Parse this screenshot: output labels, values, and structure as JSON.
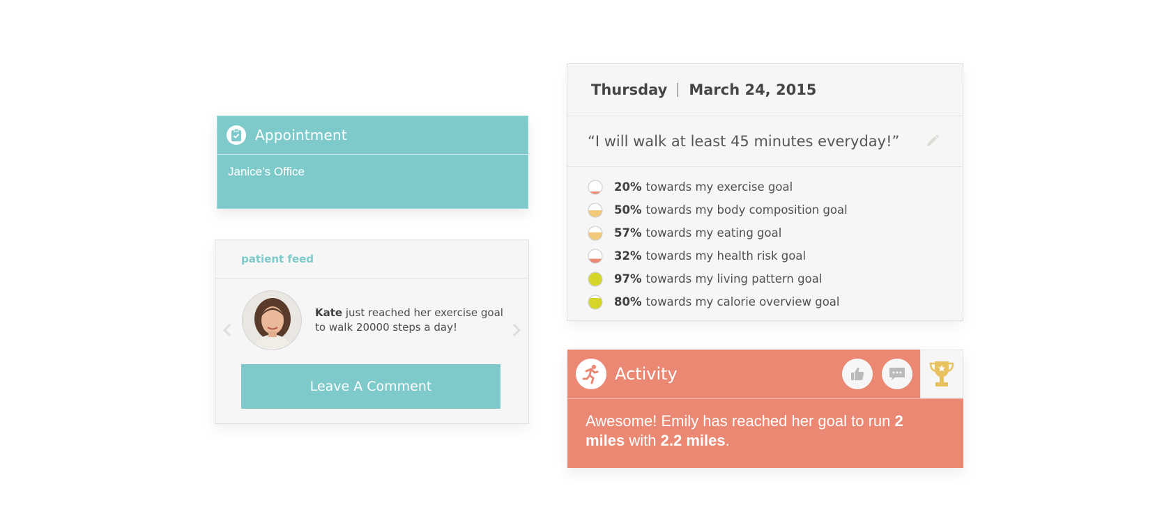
{
  "appointment": {
    "icon": "clipboard-check-icon",
    "title": "Appointment",
    "location": "Janice’s Office"
  },
  "feed": {
    "title": "patient feed",
    "post": {
      "name": "Kate",
      "text": " just reached her exercise goal to walk 20000 steps a day!"
    },
    "comment_button": "Leave A Comment"
  },
  "goals": {
    "day": "Thursday",
    "date": "March 24, 2015",
    "quote": "“I will walk at least 45 minutes everyday!”",
    "items": [
      {
        "percent": "20%",
        "label": "towards my exercise goal",
        "level": 0.2,
        "color": "#ea8873"
      },
      {
        "percent": "50%",
        "label": "towards my body composition goal",
        "level": 0.5,
        "color": "#f2c97a"
      },
      {
        "percent": "57%",
        "label": "towards my eating goal",
        "level": 0.57,
        "color": "#f2c97a"
      },
      {
        "percent": "32%",
        "label": "towards my health risk goal",
        "level": 0.32,
        "color": "#ea8873"
      },
      {
        "percent": "97%",
        "label": "towards my living pattern goal",
        "level": 0.97,
        "color": "#d6d62a"
      },
      {
        "percent": "80%",
        "label": "towards my calorie overview goal",
        "level": 0.8,
        "color": "#d6d62a"
      }
    ]
  },
  "activity": {
    "icon": "runner-icon",
    "title": "Activity",
    "message_start": "Awesome! Emily has reached her goal to run ",
    "goal": "2 miles",
    "message_mid": " with ",
    "achieved": "2.2 miles",
    "message_end": "."
  },
  "colors": {
    "teal": "#7ecacb",
    "coral": "#ea8873",
    "card_bg": "#f5f6f5",
    "gold": "#e8c25e"
  }
}
